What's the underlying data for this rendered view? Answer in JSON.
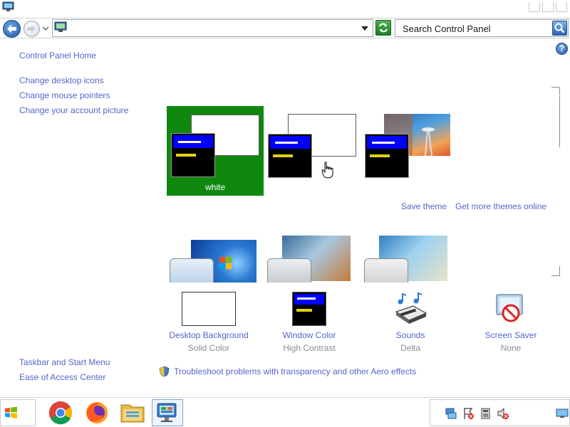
{
  "window": {
    "title_icon": "control-panel-monitor-icon"
  },
  "navbar": {
    "address_icon": "control-panel-monitor-icon",
    "search_placeholder": "Search Control Panel"
  },
  "help": {
    "label": "?"
  },
  "sidebar": {
    "home": "Control Panel Home",
    "links": [
      "Change desktop icons",
      "Change mouse pointers",
      "Change your account picture"
    ],
    "see_also": [
      "Taskbar and Start Menu",
      "Ease of Access Center"
    ]
  },
  "themes": {
    "selected_label": "white",
    "save_theme": "Save theme",
    "get_more": "Get more themes online"
  },
  "bottom": {
    "desktop_background": {
      "label": "Desktop Background",
      "value": "Solid Color"
    },
    "window_color": {
      "label": "Window Color",
      "value": "High Contrast"
    },
    "sounds": {
      "label": "Sounds",
      "value": "Delta"
    },
    "screen_saver": {
      "label": "Screen Saver",
      "value": "None"
    }
  },
  "aero_link": "Troubleshoot problems with transparency and other Aero effects",
  "colors": {
    "link": "#5565c9",
    "selected_theme_bg": "#108810",
    "hc_title": "#0000ff",
    "hc_text": "#e3d20f"
  },
  "taskbar": {
    "apps": [
      "chrome-icon",
      "firefox-icon",
      "file-explorer-icon",
      "control-panel-icon"
    ],
    "tray": [
      "network-icon",
      "action-center-icon",
      "battery-icon",
      "volume-muted-icon",
      "show-desktop-icon"
    ]
  }
}
